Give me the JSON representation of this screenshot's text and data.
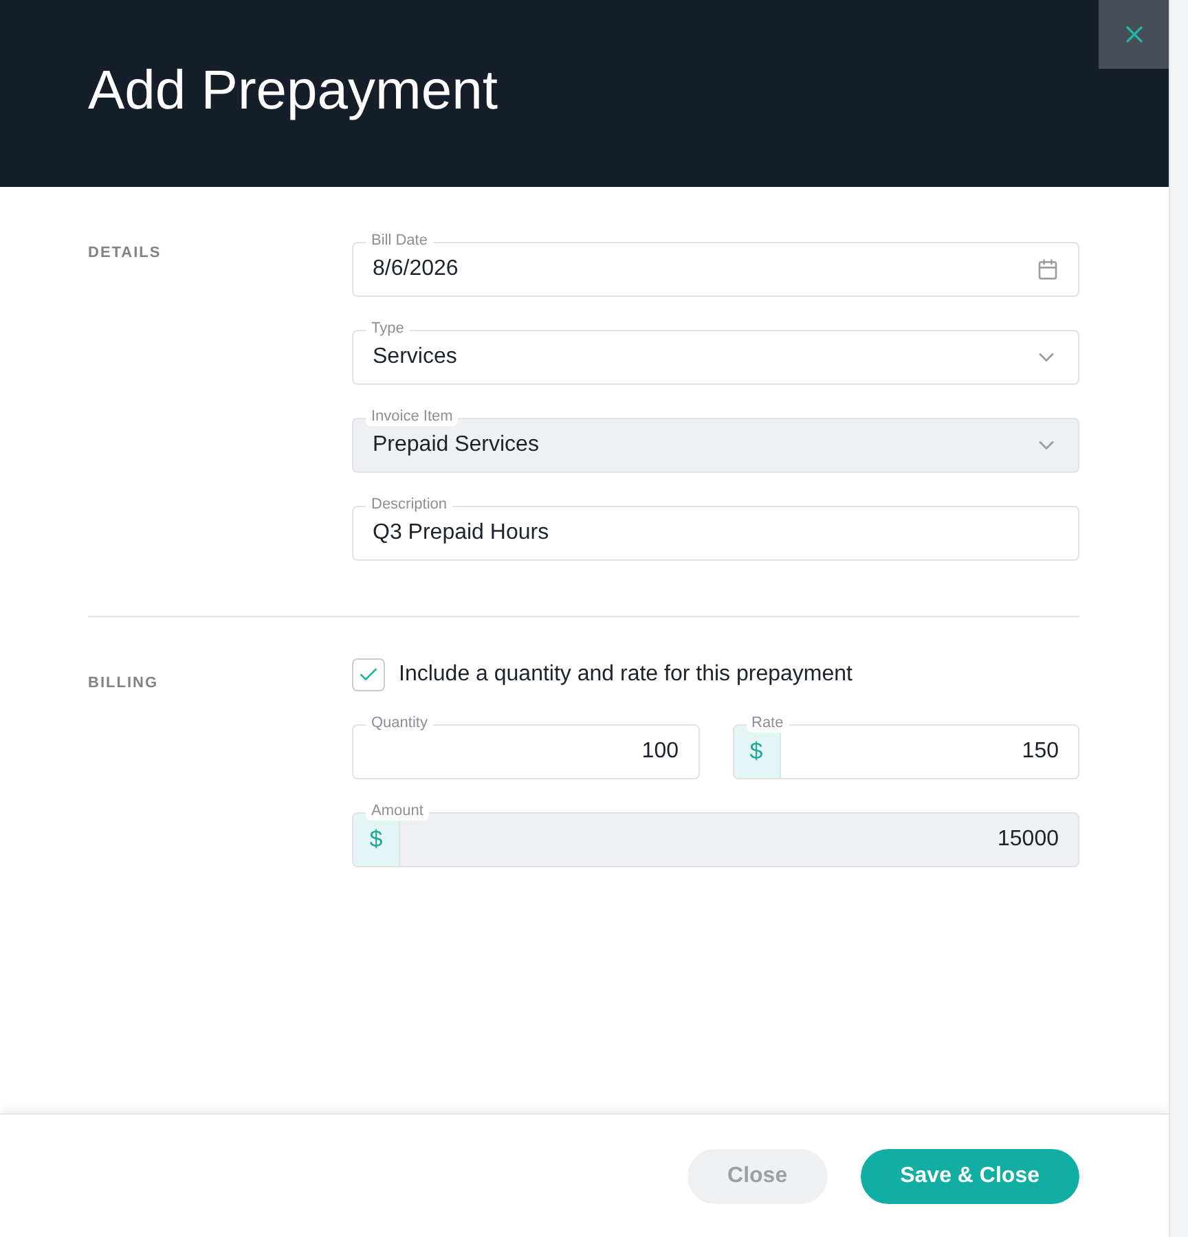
{
  "dialog": {
    "title": "Add Prepayment"
  },
  "sections": [
    {
      "label": "DETAILS",
      "fields": [
        {
          "kind": "date",
          "label": "Bill Date",
          "value": "8/6/2026",
          "disabled": false
        },
        {
          "kind": "select",
          "label": "Type",
          "value": "Services",
          "disabled": false
        },
        {
          "kind": "select",
          "label": "Invoice Item",
          "value": "Prepaid Services",
          "disabled": true
        },
        {
          "kind": "text",
          "label": "Description",
          "value": "Q3 Prepaid Hours",
          "disabled": false
        }
      ]
    },
    {
      "label": "BILLING",
      "checkbox": {
        "label": "Include a quantity and rate for this prepayment",
        "checked": true
      },
      "pairs": [
        [
          {
            "kind": "number",
            "label": "Quantity",
            "value": "100",
            "disabled": false
          },
          {
            "kind": "money",
            "label": "Rate",
            "prefix": "$",
            "value": "150",
            "disabled": false
          }
        ],
        [
          {
            "kind": "money",
            "label": "Amount",
            "prefix": "$",
            "value": "15000",
            "disabled": true
          }
        ]
      ]
    }
  ],
  "buttons": [
    {
      "label": "Close",
      "primary": false
    },
    {
      "label": "Save & Close",
      "primary": true
    }
  ]
}
